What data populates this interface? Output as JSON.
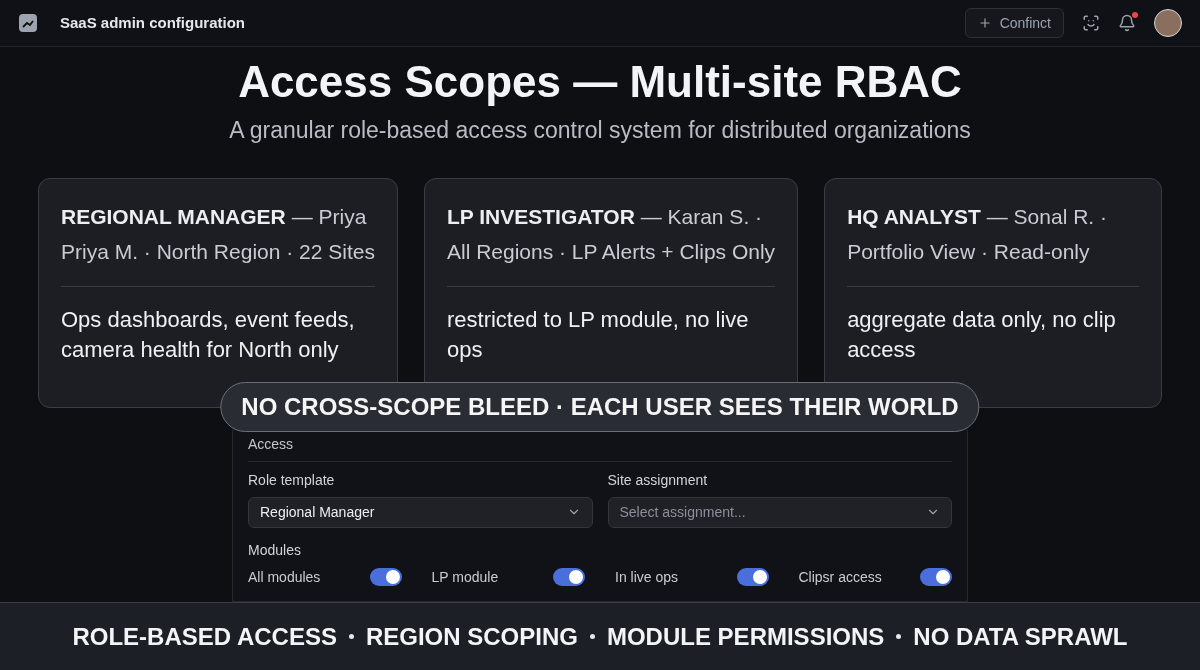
{
  "topbar": {
    "title": "SaaS admin configuration",
    "action_button": "Confinct",
    "notifications_unread": true
  },
  "hero": {
    "title": "Access Scopes — Multi-site RBAC",
    "subtitle": "A granular role-based access control system for distributed organizations"
  },
  "cards": [
    {
      "title": "**REGIONAL MANAGER** — Priya",
      "detail": "Priya M. · North Region · 22 Sites",
      "description": "Ops dashboards, event feeds, camera health for North only"
    },
    {
      "title": "**LP INVESTIGATOR** — Karan S. ·",
      "detail": "All Regions · LP Alerts + Clips Only",
      "description": "restricted to LP module, no live ops"
    },
    {
      "title": "**HQ ANALYST** — Sonal R. ·",
      "detail": "Portfolio View · Read-only",
      "description": "aggregate data only, no clip access"
    }
  ],
  "callout": "NO CROSS-SCOPE BLEED · EACH USER SEES THEIR WORLD",
  "access_panel": {
    "heading": "Access",
    "fields": [
      {
        "label": "Role template",
        "value": "Regional Manager"
      },
      {
        "label": "Site assignment",
        "placeholder": "Select assignment..."
      }
    ],
    "modules_label": "Modules",
    "modules": [
      {
        "label": "All modules",
        "on": true
      },
      {
        "label": "LP module",
        "on": true
      },
      {
        "label": "In live ops",
        "on": true
      },
      {
        "label": "Clipsr access",
        "on": true
      }
    ]
  },
  "banner": [
    "ROLE-BASED ACCESS",
    "REGION SCOPING",
    "MODULE PERMISSIONS",
    "NO DATA SPRAWL"
  ]
}
